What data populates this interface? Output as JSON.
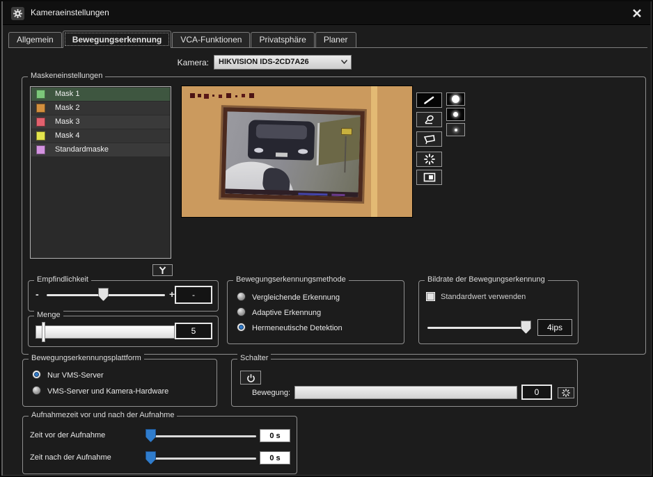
{
  "window": {
    "title": "Kameraeinstellungen"
  },
  "tabs": [
    {
      "label": "Allgemein",
      "active": false
    },
    {
      "label": "Bewegungserkennung",
      "active": true
    },
    {
      "label": "VCA-Funktionen",
      "active": false
    },
    {
      "label": "Privatsphäre",
      "active": false
    },
    {
      "label": "Planer",
      "active": false
    }
  ],
  "camera": {
    "label": "Kamera:",
    "selected": "HIKVISION IDS-2CD7A26"
  },
  "mask_settings": {
    "legend": "Maskeneinstellungen",
    "masks": [
      {
        "name": "Mask 1",
        "color": "#7cc87a",
        "selected": true
      },
      {
        "name": "Mask 2",
        "color": "#d28f3e",
        "selected": false
      },
      {
        "name": "Mask 3",
        "color": "#e2616e",
        "selected": false
      },
      {
        "name": "Mask 4",
        "color": "#e3e44d",
        "selected": false
      },
      {
        "name": "Standardmaske",
        "color": "#d393e0",
        "selected": false
      }
    ],
    "toolbar_icons": [
      "pen-icon",
      "eraser-icon",
      "polygon-icon",
      "refresh-icon",
      "fill-frame-icon"
    ],
    "brush_size_icons": [
      "brush-dot-large",
      "brush-dot-medium",
      "brush-dot-small"
    ],
    "wrench_icon": "wrench-icon"
  },
  "sensitivity": {
    "legend": "Empfindlichkeit",
    "minus": "-",
    "plus": "+",
    "value": "-",
    "slider_percent": 48
  },
  "amount": {
    "legend": "Menge",
    "value": "5",
    "slider_percent": 5
  },
  "method": {
    "legend": "Bewegungserkennungsmethode",
    "options": [
      {
        "label": "Vergleichende Erkennung",
        "selected": false
      },
      {
        "label": "Adaptive Erkennung",
        "selected": false
      },
      {
        "label": "Hermeneutische Detektion",
        "selected": true
      }
    ]
  },
  "framerate": {
    "legend": "Bildrate der Bewegungserkennung",
    "checkbox_label": "Standardwert verwenden",
    "checked": false,
    "value": "4ips",
    "slider_percent": 92
  },
  "platform": {
    "legend": "Bewegungserkennungsplattform",
    "options": [
      {
        "label": "Nur VMS-Server",
        "selected": true
      },
      {
        "label": "VMS-Server und Kamera-Hardware",
        "selected": false
      }
    ]
  },
  "switch": {
    "legend": "Schalter",
    "power_icon": "power-icon",
    "motion_label": "Bewegung:",
    "value": "0",
    "progress_percent": 0,
    "reset_icon": "refresh-icon"
  },
  "recording": {
    "legend": "Aufnahmezeit vor und nach der Aufnahme",
    "rows": [
      {
        "label": "Zeit vor der Aufnahme",
        "value": "0 s",
        "slider_percent": 2
      },
      {
        "label": "Zeit nach der Aufnahme",
        "value": "0 s",
        "slider_percent": 2
      }
    ]
  },
  "colors": {
    "selection_green": "#3e5640",
    "radio_blue": "#2f7ac9",
    "slider_blue": "#2f7ccc",
    "mask_overlay_orange": "#cb9a5e"
  }
}
